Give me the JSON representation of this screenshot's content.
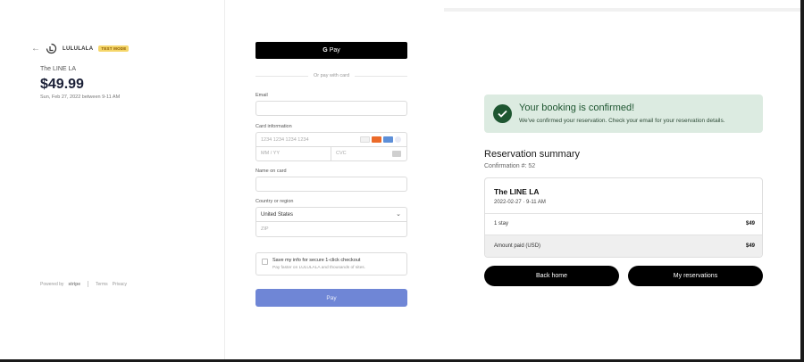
{
  "summary": {
    "brand_name": "LULULALA",
    "test_badge": "TEST MODE",
    "merchant": "The LINE LA",
    "price": "$49.99",
    "date_text": "Sun, Feb 27, 2022 between 9-11 AM",
    "footer": {
      "powered_by": "Powered by",
      "stripe": "stripe",
      "terms": "Terms",
      "privacy": "Privacy"
    }
  },
  "payment_form": {
    "gpay_label": "Pay",
    "gpay_g": "G",
    "or_text": "Or pay with card",
    "email_label": "Email",
    "email_value": "",
    "card_label": "Card information",
    "card_number_placeholder": "1234 1234 1234 1234",
    "expiry_placeholder": "MM / YY",
    "cvc_placeholder": "CVC",
    "name_label": "Name on card",
    "name_value": "",
    "country_label": "Country or region",
    "country_value": "United States",
    "zip_placeholder": "ZIP",
    "save_title": "Save my info for secure 1-click checkout",
    "save_subtitle": "Pay faster on LULULALA and thousands of sites.",
    "pay_button": "Pay",
    "card_brand_colors": [
      "#f2f2f2",
      "#eb6a2a",
      "#5d8fd8",
      "#e8eaf5"
    ]
  },
  "confirmation": {
    "banner_title": "Your booking is confirmed!",
    "banner_text": "We've confirmed your reservation. Check your email for your reservation details.",
    "summary_title": "Reservation summary",
    "confirmation_number": "Confirmation #: 52",
    "venue": "The LINE LA",
    "datetime": "2022-02-27 · 9-11 AM",
    "rows": [
      {
        "label": "1 stay",
        "amount": "$49"
      },
      {
        "label": "Amount paid (USD)",
        "amount": "$49"
      }
    ],
    "back_home_button": "Back home",
    "my_reservations_button": "My reservations",
    "accent_color": "#1e5631"
  }
}
